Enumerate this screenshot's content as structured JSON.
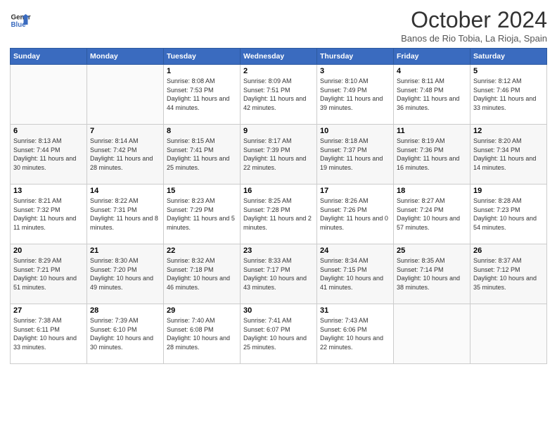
{
  "header": {
    "logo_line1": "General",
    "logo_line2": "Blue",
    "month": "October 2024",
    "location": "Banos de Rio Tobia, La Rioja, Spain"
  },
  "weekdays": [
    "Sunday",
    "Monday",
    "Tuesday",
    "Wednesday",
    "Thursday",
    "Friday",
    "Saturday"
  ],
  "weeks": [
    [
      {
        "day": "",
        "sunrise": "",
        "sunset": "",
        "daylight": ""
      },
      {
        "day": "",
        "sunrise": "",
        "sunset": "",
        "daylight": ""
      },
      {
        "day": "1",
        "sunrise": "Sunrise: 8:08 AM",
        "sunset": "Sunset: 7:53 PM",
        "daylight": "Daylight: 11 hours and 44 minutes."
      },
      {
        "day": "2",
        "sunrise": "Sunrise: 8:09 AM",
        "sunset": "Sunset: 7:51 PM",
        "daylight": "Daylight: 11 hours and 42 minutes."
      },
      {
        "day": "3",
        "sunrise": "Sunrise: 8:10 AM",
        "sunset": "Sunset: 7:49 PM",
        "daylight": "Daylight: 11 hours and 39 minutes."
      },
      {
        "day": "4",
        "sunrise": "Sunrise: 8:11 AM",
        "sunset": "Sunset: 7:48 PM",
        "daylight": "Daylight: 11 hours and 36 minutes."
      },
      {
        "day": "5",
        "sunrise": "Sunrise: 8:12 AM",
        "sunset": "Sunset: 7:46 PM",
        "daylight": "Daylight: 11 hours and 33 minutes."
      }
    ],
    [
      {
        "day": "6",
        "sunrise": "Sunrise: 8:13 AM",
        "sunset": "Sunset: 7:44 PM",
        "daylight": "Daylight: 11 hours and 30 minutes."
      },
      {
        "day": "7",
        "sunrise": "Sunrise: 8:14 AM",
        "sunset": "Sunset: 7:42 PM",
        "daylight": "Daylight: 11 hours and 28 minutes."
      },
      {
        "day": "8",
        "sunrise": "Sunrise: 8:15 AM",
        "sunset": "Sunset: 7:41 PM",
        "daylight": "Daylight: 11 hours and 25 minutes."
      },
      {
        "day": "9",
        "sunrise": "Sunrise: 8:17 AM",
        "sunset": "Sunset: 7:39 PM",
        "daylight": "Daylight: 11 hours and 22 minutes."
      },
      {
        "day": "10",
        "sunrise": "Sunrise: 8:18 AM",
        "sunset": "Sunset: 7:37 PM",
        "daylight": "Daylight: 11 hours and 19 minutes."
      },
      {
        "day": "11",
        "sunrise": "Sunrise: 8:19 AM",
        "sunset": "Sunset: 7:36 PM",
        "daylight": "Daylight: 11 hours and 16 minutes."
      },
      {
        "day": "12",
        "sunrise": "Sunrise: 8:20 AM",
        "sunset": "Sunset: 7:34 PM",
        "daylight": "Daylight: 11 hours and 14 minutes."
      }
    ],
    [
      {
        "day": "13",
        "sunrise": "Sunrise: 8:21 AM",
        "sunset": "Sunset: 7:32 PM",
        "daylight": "Daylight: 11 hours and 11 minutes."
      },
      {
        "day": "14",
        "sunrise": "Sunrise: 8:22 AM",
        "sunset": "Sunset: 7:31 PM",
        "daylight": "Daylight: 11 hours and 8 minutes."
      },
      {
        "day": "15",
        "sunrise": "Sunrise: 8:23 AM",
        "sunset": "Sunset: 7:29 PM",
        "daylight": "Daylight: 11 hours and 5 minutes."
      },
      {
        "day": "16",
        "sunrise": "Sunrise: 8:25 AM",
        "sunset": "Sunset: 7:28 PM",
        "daylight": "Daylight: 11 hours and 2 minutes."
      },
      {
        "day": "17",
        "sunrise": "Sunrise: 8:26 AM",
        "sunset": "Sunset: 7:26 PM",
        "daylight": "Daylight: 11 hours and 0 minutes."
      },
      {
        "day": "18",
        "sunrise": "Sunrise: 8:27 AM",
        "sunset": "Sunset: 7:24 PM",
        "daylight": "Daylight: 10 hours and 57 minutes."
      },
      {
        "day": "19",
        "sunrise": "Sunrise: 8:28 AM",
        "sunset": "Sunset: 7:23 PM",
        "daylight": "Daylight: 10 hours and 54 minutes."
      }
    ],
    [
      {
        "day": "20",
        "sunrise": "Sunrise: 8:29 AM",
        "sunset": "Sunset: 7:21 PM",
        "daylight": "Daylight: 10 hours and 51 minutes."
      },
      {
        "day": "21",
        "sunrise": "Sunrise: 8:30 AM",
        "sunset": "Sunset: 7:20 PM",
        "daylight": "Daylight: 10 hours and 49 minutes."
      },
      {
        "day": "22",
        "sunrise": "Sunrise: 8:32 AM",
        "sunset": "Sunset: 7:18 PM",
        "daylight": "Daylight: 10 hours and 46 minutes."
      },
      {
        "day": "23",
        "sunrise": "Sunrise: 8:33 AM",
        "sunset": "Sunset: 7:17 PM",
        "daylight": "Daylight: 10 hours and 43 minutes."
      },
      {
        "day": "24",
        "sunrise": "Sunrise: 8:34 AM",
        "sunset": "Sunset: 7:15 PM",
        "daylight": "Daylight: 10 hours and 41 minutes."
      },
      {
        "day": "25",
        "sunrise": "Sunrise: 8:35 AM",
        "sunset": "Sunset: 7:14 PM",
        "daylight": "Daylight: 10 hours and 38 minutes."
      },
      {
        "day": "26",
        "sunrise": "Sunrise: 8:37 AM",
        "sunset": "Sunset: 7:12 PM",
        "daylight": "Daylight: 10 hours and 35 minutes."
      }
    ],
    [
      {
        "day": "27",
        "sunrise": "Sunrise: 7:38 AM",
        "sunset": "Sunset: 6:11 PM",
        "daylight": "Daylight: 10 hours and 33 minutes."
      },
      {
        "day": "28",
        "sunrise": "Sunrise: 7:39 AM",
        "sunset": "Sunset: 6:10 PM",
        "daylight": "Daylight: 10 hours and 30 minutes."
      },
      {
        "day": "29",
        "sunrise": "Sunrise: 7:40 AM",
        "sunset": "Sunset: 6:08 PM",
        "daylight": "Daylight: 10 hours and 28 minutes."
      },
      {
        "day": "30",
        "sunrise": "Sunrise: 7:41 AM",
        "sunset": "Sunset: 6:07 PM",
        "daylight": "Daylight: 10 hours and 25 minutes."
      },
      {
        "day": "31",
        "sunrise": "Sunrise: 7:43 AM",
        "sunset": "Sunset: 6:06 PM",
        "daylight": "Daylight: 10 hours and 22 minutes."
      },
      {
        "day": "",
        "sunrise": "",
        "sunset": "",
        "daylight": ""
      },
      {
        "day": "",
        "sunrise": "",
        "sunset": "",
        "daylight": ""
      }
    ]
  ]
}
